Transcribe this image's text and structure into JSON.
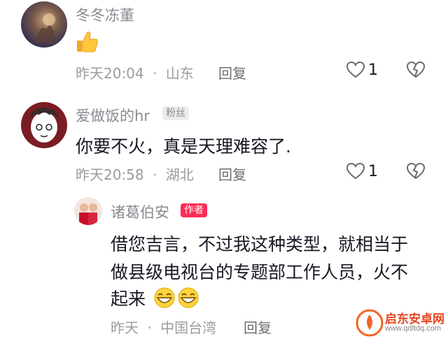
{
  "comments": [
    {
      "username": "冬冬冻董",
      "content": "",
      "emoji": "thumbs-up",
      "time": "昨天20:04",
      "separator": "·",
      "location": "山东",
      "reply": "回复",
      "likes": "1"
    },
    {
      "username": "爱做饭的hr",
      "badge": "粉丝",
      "content": "你要不火，真是天理难容了.",
      "time": "昨天20:58",
      "separator": "·",
      "location": "湖北",
      "reply": "回复",
      "likes": "1"
    }
  ],
  "author_reply": {
    "username": "诸葛伯安",
    "badge": "作者",
    "content_lines": [
      "借您吉言，不过我这种类型，就相当于",
      "做县级电视台的专题部工作人员，火不",
      "起来"
    ],
    "emoji": "grinning-face",
    "time": "昨天",
    "separator": "·",
    "location": "中国台湾",
    "reply": "回复"
  },
  "watermark": {
    "title": "启东安卓网",
    "url": "www.qdltdq.com"
  },
  "colors": {
    "accent": "#fe2c55",
    "meta": "#9a9ba0",
    "text": "#161823"
  }
}
